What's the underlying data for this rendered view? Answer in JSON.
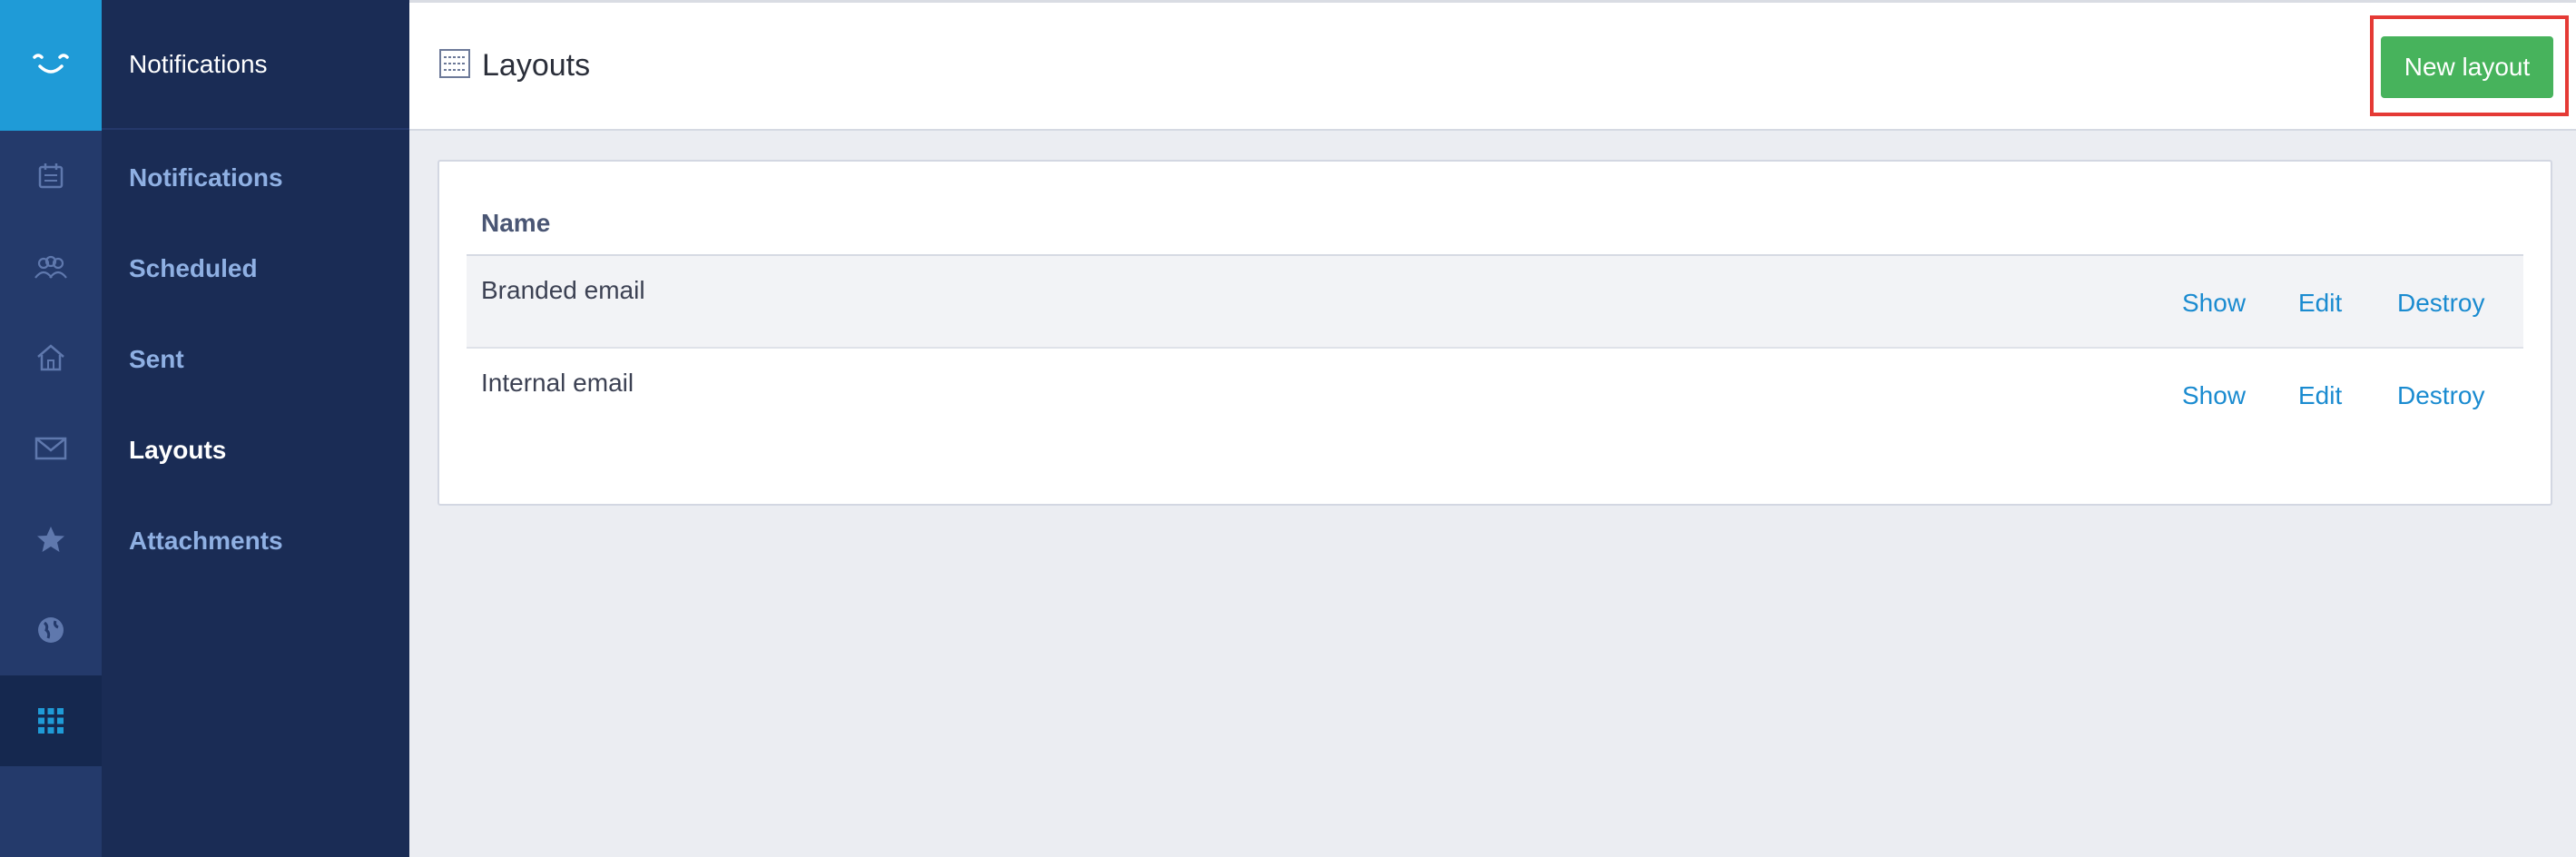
{
  "rail": {
    "icons": [
      "logo-icon",
      "calendar-icon",
      "users-icon",
      "home-icon",
      "mail-icon",
      "star-icon",
      "globe-icon",
      "grid-icon"
    ],
    "logo_color": "#1f9bd7"
  },
  "nav": {
    "header": "Notifications",
    "items": [
      {
        "label": "Notifications"
      },
      {
        "label": "Scheduled"
      },
      {
        "label": "Sent"
      },
      {
        "label": "Layouts"
      },
      {
        "label": "Attachments"
      }
    ],
    "active": "Layouts"
  },
  "header": {
    "title": "Layouts",
    "new_button": "New layout",
    "button_color": "#47b35c"
  },
  "table": {
    "column_name": "Name",
    "rows": [
      {
        "name": "Branded email",
        "actions": [
          "Show",
          "Edit",
          "Destroy"
        ]
      },
      {
        "name": "Internal email",
        "actions": [
          "Show",
          "Edit",
          "Destroy"
        ]
      }
    ]
  }
}
